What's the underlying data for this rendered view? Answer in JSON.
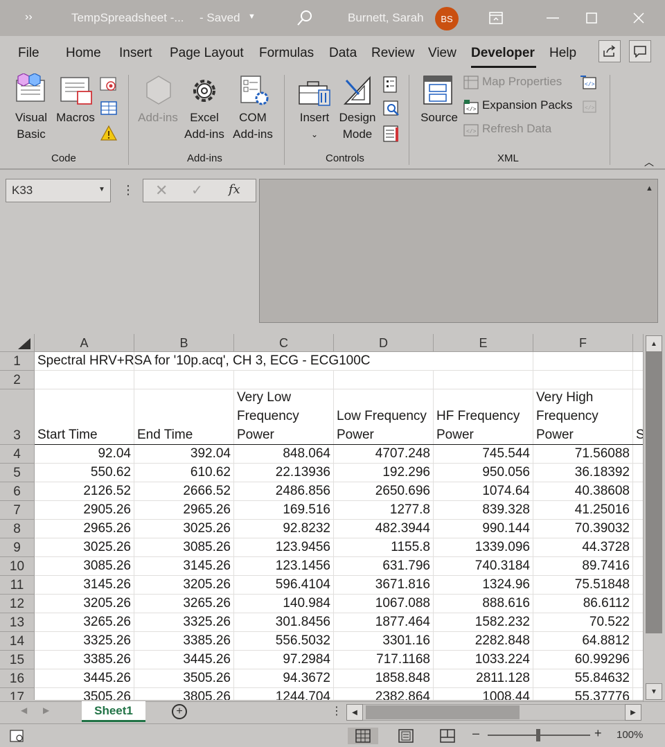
{
  "window": {
    "more_glyph": "››",
    "title": "TempSpreadsheet -...",
    "save_status": "- Saved",
    "user_name": "Burnett, Sarah",
    "user_initials": "BS"
  },
  "menu": {
    "tabs": [
      "File",
      "Home",
      "Insert",
      "Page Layout",
      "Formulas",
      "Data",
      "Review",
      "View",
      "Developer",
      "Help"
    ],
    "active_tab": "Developer"
  },
  "ribbon": {
    "groups": {
      "code": "Code",
      "addins": "Add-ins",
      "controls": "Controls",
      "xml": "XML"
    },
    "buttons": {
      "visual_basic": "Visual Basic",
      "macros": "Macros",
      "addins": "Add-ins",
      "excel_addins": "Excel Add-ins",
      "com_addins": "COM Add-ins",
      "insert": "Insert",
      "design_mode": "Design Mode",
      "source": "Source",
      "map_properties": "Map Properties",
      "expansion_packs": "Expansion Packs",
      "refresh_data": "Refresh Data"
    }
  },
  "formula_bar": {
    "name_box": "K33",
    "fx_label": "fx",
    "formula": ""
  },
  "sheet": {
    "columns": [
      "A",
      "B",
      "C",
      "D",
      "E",
      "F"
    ],
    "title_cell": "Spectral HRV+RSA for '10p.acq', CH 3, ECG - ECG100C",
    "headers": [
      "Start Time",
      "End Time",
      "Very Low Frequency Power",
      "Low Frequency Power",
      "HF Frequency Power",
      "Very High Frequency Power"
    ],
    "overflow_header_char": "S",
    "row_numbers": [
      "1",
      "2",
      "3",
      "4",
      "5",
      "6",
      "7",
      "8",
      "9",
      "10",
      "11",
      "12",
      "13",
      "14",
      "15",
      "16",
      "17"
    ],
    "rows": [
      [
        "92.04",
        "392.04",
        "848.064",
        "4707.248",
        "745.544",
        "71.56088"
      ],
      [
        "550.62",
        "610.62",
        "22.13936",
        "192.296",
        "950.056",
        "36.18392"
      ],
      [
        "2126.52",
        "2666.52",
        "2486.856",
        "2650.696",
        "1074.64",
        "40.38608"
      ],
      [
        "2905.26",
        "2965.26",
        "169.516",
        "1277.8",
        "839.328",
        "41.25016"
      ],
      [
        "2965.26",
        "3025.26",
        "92.8232",
        "482.3944",
        "990.144",
        "70.39032"
      ],
      [
        "3025.26",
        "3085.26",
        "123.9456",
        "1155.8",
        "1339.096",
        "44.3728"
      ],
      [
        "3085.26",
        "3145.26",
        "123.1456",
        "631.796",
        "740.3184",
        "89.7416"
      ],
      [
        "3145.26",
        "3205.26",
        "596.4104",
        "3671.816",
        "1324.96",
        "75.51848"
      ],
      [
        "3205.26",
        "3265.26",
        "140.984",
        "1067.088",
        "888.616",
        "86.6112"
      ],
      [
        "3265.26",
        "3325.26",
        "301.8456",
        "1877.464",
        "1582.232",
        "70.522"
      ],
      [
        "3325.26",
        "3385.26",
        "556.5032",
        "3301.16",
        "2282.848",
        "64.8812"
      ],
      [
        "3385.26",
        "3445.26",
        "97.2984",
        "717.1168",
        "1033.224",
        "60.99296"
      ],
      [
        "3445.26",
        "3505.26",
        "94.3672",
        "1858.848",
        "2811.128",
        "55.84632"
      ],
      [
        "3505.26",
        "3805.26",
        "1244.704",
        "2382.864",
        "1008.44",
        "55.37776"
      ]
    ]
  },
  "sheet_tabs": {
    "active": "Sheet1"
  },
  "status_bar": {
    "zoom": "100%"
  },
  "colors": {
    "accent_green": "#217346",
    "avatar": "#ca5010"
  }
}
